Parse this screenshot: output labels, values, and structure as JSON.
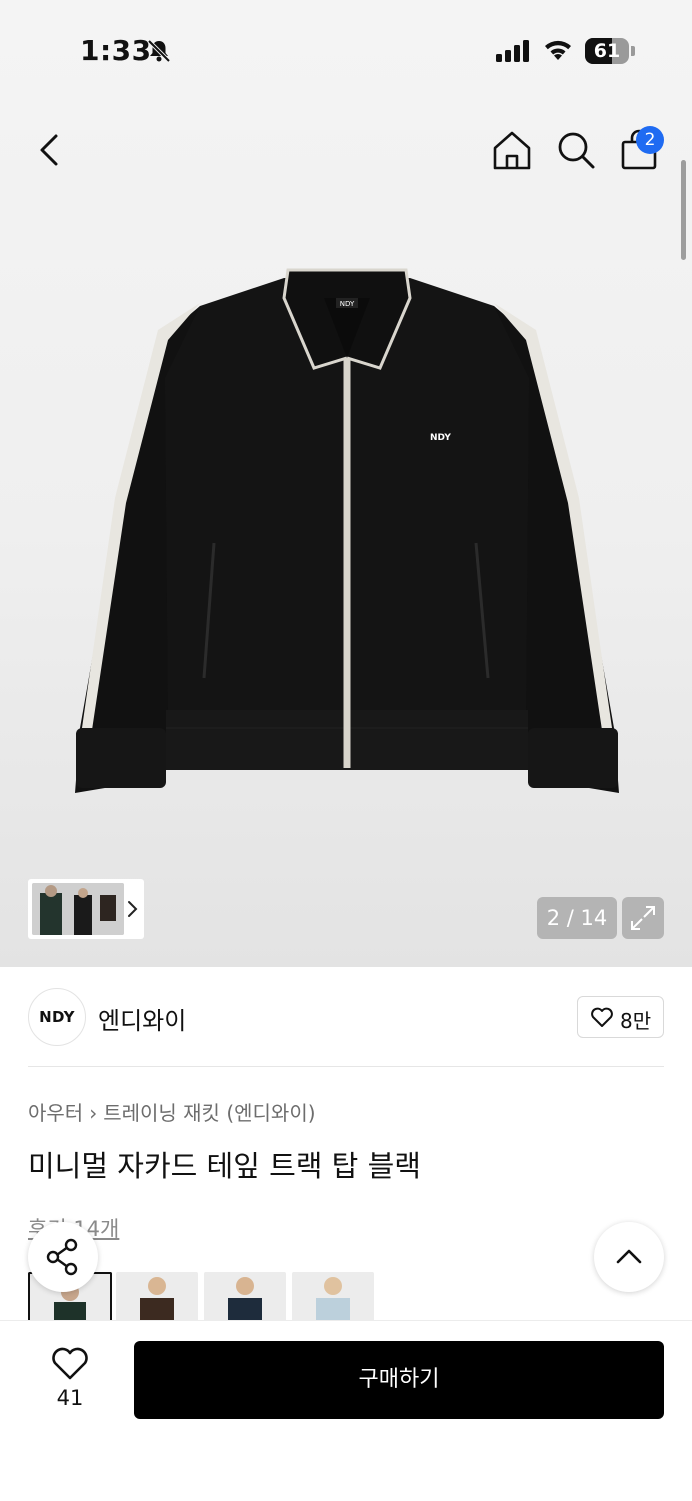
{
  "status_bar": {
    "time": "1:33",
    "battery": "61",
    "battery_level": 0.61
  },
  "header": {
    "cart_badge": "2"
  },
  "gallery": {
    "counter": "2 / 14"
  },
  "brand": {
    "logo_text": "NDY",
    "name": "엔디와이",
    "likes": "8만"
  },
  "breadcrumb": {
    "category": "아우터",
    "subcategory": "트레이닝 재킷 (엔디와이)"
  },
  "product": {
    "title": "미니멀 자카드 테잎 트랙 탑 블랙",
    "review_link": "후기 14개"
  },
  "bottom_bar": {
    "wish_count": "41",
    "buy_label": "구매하기"
  },
  "icons": [
    "bell-slash-icon",
    "signal-icon",
    "wifi-icon",
    "back-icon",
    "home-icon",
    "search-icon",
    "bag-icon",
    "expand-icon",
    "heart-icon",
    "share-icon",
    "chevron-up-icon",
    "chevron-right-icon"
  ]
}
